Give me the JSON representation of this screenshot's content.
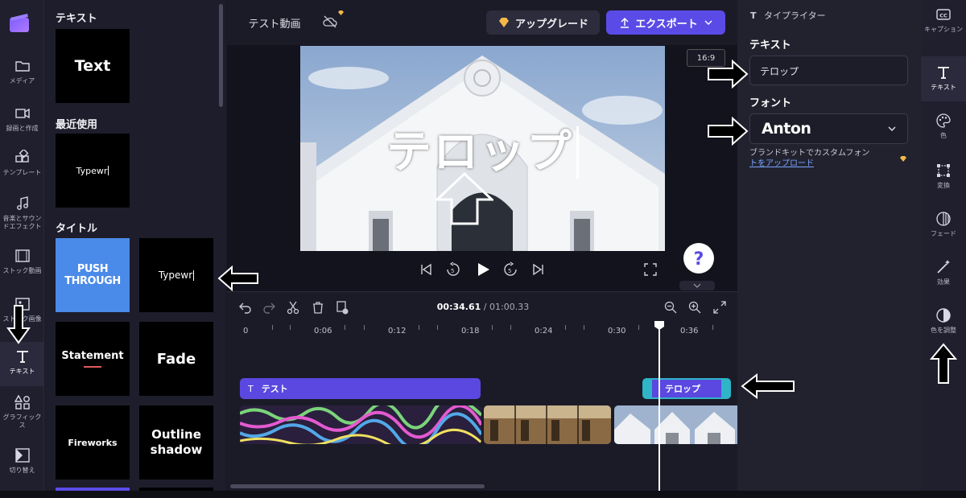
{
  "left_nav": {
    "items": [
      {
        "label": "メディア",
        "icon": "folder-icon"
      },
      {
        "label": "録画と作成",
        "icon": "camera-icon"
      },
      {
        "label": "テンプレート",
        "icon": "template-icon"
      },
      {
        "label": "音楽とサウンドエフェクト",
        "icon": "music-note-icon"
      },
      {
        "label": "ストック動画",
        "icon": "film-icon"
      },
      {
        "label": "ストック画像",
        "icon": "image-icon"
      },
      {
        "label": "テキスト",
        "icon": "text-icon"
      },
      {
        "label": "グラフィックス",
        "icon": "shapes-icon"
      },
      {
        "label": "切り替え",
        "icon": "transition-icon"
      }
    ]
  },
  "text_panel": {
    "section_text": "テキスト",
    "section_recent": "最近使用",
    "section_titles": "タイトル",
    "tile_text": "Text",
    "tile_recent": "Typewr",
    "tiles": [
      "PUSH THROUGH",
      "Typewr",
      "Statement",
      "Fade",
      "Fireworks",
      "Outline shadow"
    ]
  },
  "topbar": {
    "project_name": "テスト動画",
    "upgrade_label": "アップグレード",
    "export_label": "エクスポート"
  },
  "preview": {
    "aspect_ratio": "16:9",
    "overlay_text": "テロップ"
  },
  "timeline": {
    "timecode": "00:34.61",
    "duration": "/ 01:00.33",
    "ruler": [
      "0",
      "0:06",
      "0:12",
      "0:18",
      "0:24",
      "0:30",
      "0:36"
    ],
    "clip_text1": "テスト",
    "clip_text2": "テロップ"
  },
  "props": {
    "header": "タイプライター",
    "text_label": "テキスト",
    "text_value": "テロップ",
    "font_label": "フォント",
    "font_value": "Anton",
    "brand_note_line1": "ブランドキットでカスタムフォン",
    "brand_note_line2": "トをアップロード"
  },
  "right_tools": {
    "items": [
      {
        "label": "キャプション",
        "icon": "captions-icon"
      },
      {
        "label": "テキスト",
        "icon": "text-icon"
      },
      {
        "label": "色",
        "icon": "palette-icon"
      },
      {
        "label": "変換",
        "icon": "transform-icon"
      },
      {
        "label": "フェード",
        "icon": "fade-icon"
      },
      {
        "label": "効果",
        "icon": "magic-wand-icon"
      },
      {
        "label": "色を調整",
        "icon": "contrast-icon"
      }
    ]
  },
  "colors": {
    "accent": "#5b4be6",
    "clip_text": "#5a48e0",
    "selected_clip": "#2fb4c8",
    "help_bubble": "#ffffff"
  }
}
